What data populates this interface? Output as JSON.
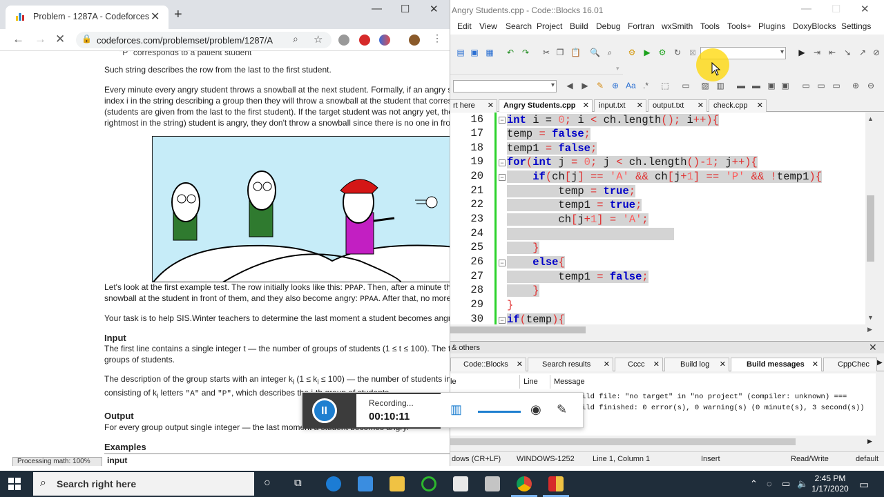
{
  "chrome": {
    "tab_title": "Problem - 1287A - Codeforces",
    "url": "codeforces.com/problemset/problem/1287/A"
  },
  "problem": {
    "top_cut": "\"P\" corresponds to a patient student",
    "p1": "Such string describes the row from the last to the first student.",
    "p2": [
      "Every minute every angry student throws a snowball at the next student. Formally, if an angry st",
      "index i in the string describing a group then they will throw a snowball at the student that corres",
      "(students are given from the last to the first student). If the target student was not angry yet, they",
      "rightmost in the string) student is angry, they don't throw a snowball since there is no one in fron"
    ],
    "p3_a": "Let's look at the first example test. The row initially looks like this: ",
    "p3_code1": "PPAP",
    "p3_b": ". Then, after a minute th",
    "p3_line2a": "snowball at the student in front of them, and they also become angry: ",
    "p3_code2": "PPAA",
    "p3_line2b": ". After that, no more",
    "p4": "Your task is to help SIS.Winter teachers to determine the last moment a student becomes angry",
    "input_heading": "Input",
    "input_p1": "The first line contains a single integer t — the number of groups of students (1 ≤ t ≤ 100). The fo",
    "input_p1b": "groups of students.",
    "input_p2a": "The description of the group starts with an integer k",
    "input_p2sub": "i",
    "input_p2b": " (1 ≤ k",
    "input_p2c": " ≤ 100) — the number of students in",
    "input_p3a": "consisting of k",
    "input_p3b": " letters ",
    "input_p3A": "\"A\"",
    "input_p3and": " and ",
    "input_p3P": "\"P\"",
    "input_p3c": ", which describes the i-th group of students.",
    "output_heading": "Output",
    "output_p1": "For every group output single integer — the last moment a student becomes angry.",
    "examples_heading": "Examples",
    "input_label": "input",
    "processing": "Processing math: 100%"
  },
  "codeblocks": {
    "title": "Angry Students.cpp - Code::Blocks 16.01",
    "menu": [
      "Edit",
      "View",
      "Search",
      "Project",
      "Build",
      "Debug",
      "Fortran",
      "wxSmith",
      "Tools",
      "Tools+",
      "Plugins",
      "DoxyBlocks",
      "Settings"
    ],
    "editor_tabs": [
      "rt here",
      "Angry Students.cpp",
      "input.txt",
      "output.txt",
      "check.cpp"
    ],
    "line_numbers": [
      "16",
      "17",
      "18",
      "19",
      "20",
      "21",
      "22",
      "23",
      "24",
      "25",
      "26",
      "27",
      "28",
      "29",
      "30"
    ],
    "logs_title": "& others",
    "log_tabs": [
      "Code::Blocks",
      "Search results",
      "Cccc",
      "Build log",
      "Build messages",
      "CppChec"
    ],
    "log_headers": [
      "le",
      "Line",
      "Message"
    ],
    "log_rows": [
      "ild file: \"no target\" in \"no project\" (compiler: unknown) ===",
      "ild finished: 0 error(s), 0 warning(s) (0 minute(s), 3 second(s))"
    ],
    "status": [
      "dows (CR+LF)",
      "WINDOWS-1252",
      "Line 1, Column 1",
      "Insert",
      "Read/Write",
      "default"
    ]
  },
  "recorder": {
    "label": "Recording...",
    "time": "00:10:11"
  },
  "taskbar": {
    "search_placeholder": "Search right here",
    "time": "2:45 PM",
    "date": "1/17/2020"
  }
}
